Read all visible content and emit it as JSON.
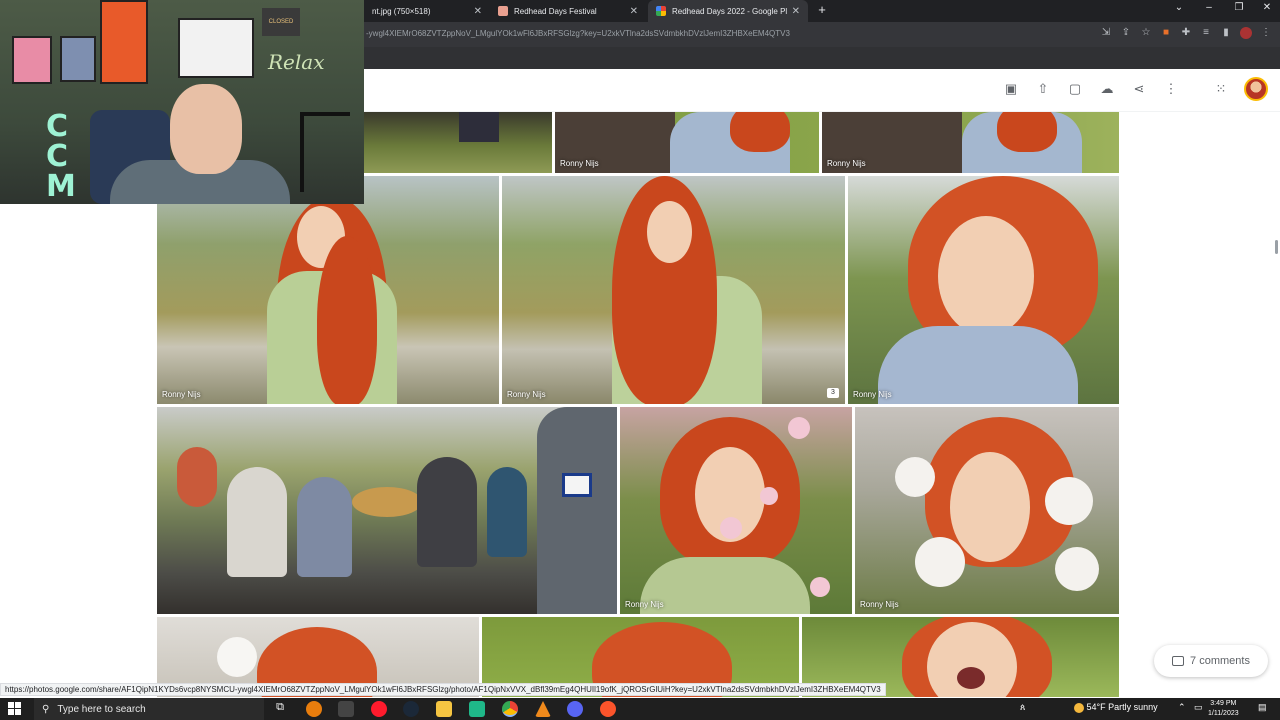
{
  "browser": {
    "tabs": [
      {
        "title": "nt.jpg (750×518)",
        "active": false
      },
      {
        "title": "Redhead Days Festival",
        "active": false
      },
      {
        "title": "Redhead Days 2022 - Google Pl",
        "active": true
      }
    ],
    "new_tab_label": "+",
    "window_controls": {
      "chevron": "⌄",
      "minimize": "–",
      "restore": "❐",
      "close": "✕"
    },
    "tab_close": "✕",
    "url": "-ywgl4XIEMrO68ZVTZppNoV_LMgulYOk1wFl6JBxRFSGlzg?key=U2xkVTlna2dsSVdmbkhDVzlJemI3ZHBXeEM4QTV3",
    "address_icons": [
      "install-icon",
      "share-icon",
      "star-icon",
      "extension-fox-icon",
      "puzzle-icon",
      "reading-list-icon",
      "sidebar-icon",
      "profile-icon",
      "menu-icon"
    ]
  },
  "photos_toolbar": {
    "icons": [
      "shopping-bag-icon",
      "upload-icon",
      "slideshow-icon",
      "cloud-download-icon",
      "share-icon",
      "more-vert-icon",
      "apps-icon",
      "account-avatar"
    ]
  },
  "photos": {
    "credit": "Ronny Nijs",
    "tiles": [
      {
        "name": "photo-top-left-crowd",
        "credit": ""
      },
      {
        "name": "photo-top-middle",
        "credit": "Ronny Nijs"
      },
      {
        "name": "photo-top-right",
        "credit": "Ronny Nijs"
      },
      {
        "name": "photo-redhead-laughing",
        "credit": "Ronny Nijs"
      },
      {
        "name": "photo-redhead-smile",
        "credit": "Ronny Nijs"
      },
      {
        "name": "photo-redhead-windy",
        "credit": "Ronny Nijs"
      },
      {
        "name": "photo-crowd-guitar",
        "credit": ""
      },
      {
        "name": "photo-redhead-flowers",
        "credit": "Ronny Nijs"
      },
      {
        "name": "photo-redhead-white-flowers",
        "credit": "Ronny Nijs"
      },
      {
        "name": "photo-bottom-left",
        "credit": ""
      },
      {
        "name": "photo-bottom-middle",
        "credit": ""
      },
      {
        "name": "photo-bottom-right-surprised",
        "credit": ""
      }
    ]
  },
  "comments": {
    "label": "7 comments"
  },
  "status_url": "https://photos.google.com/share/AF1QipN1KYDs6vcp8NYSMCU-ywgl4XIEMrO68ZVTZppNoV_LMgulYOk1wFl6JBxRFSGlzg/photo/AF1QipNxVVX_dBfl39mEg4QHUIl19ofK_jQROSrGlUiH?key=U2xkVTlna2dsSVdmbkhDVzlJemI3ZHBXeEM4QTV3",
  "webcam": {
    "letters": "C\nC\nM",
    "neon": "Relax",
    "sign": "CLOSED"
  },
  "taskbar": {
    "search_placeholder": "Type here to search",
    "weather": "54°F  Partly sunny",
    "time": "3:49 PM",
    "date": "1/11/2023",
    "apps": [
      "task-view-icon",
      "blender-icon",
      "calculator-icon",
      "opera-icon",
      "steam-icon",
      "file-explorer-icon",
      "app-green-icon",
      "chrome-icon",
      "vlc-icon",
      "discord-icon",
      "brave-icon"
    ]
  },
  "colors": {
    "chrome_dark": "#202124",
    "active_tab": "#35363a",
    "hair": "#c9471d",
    "taskbar": "#1f1f1f"
  }
}
